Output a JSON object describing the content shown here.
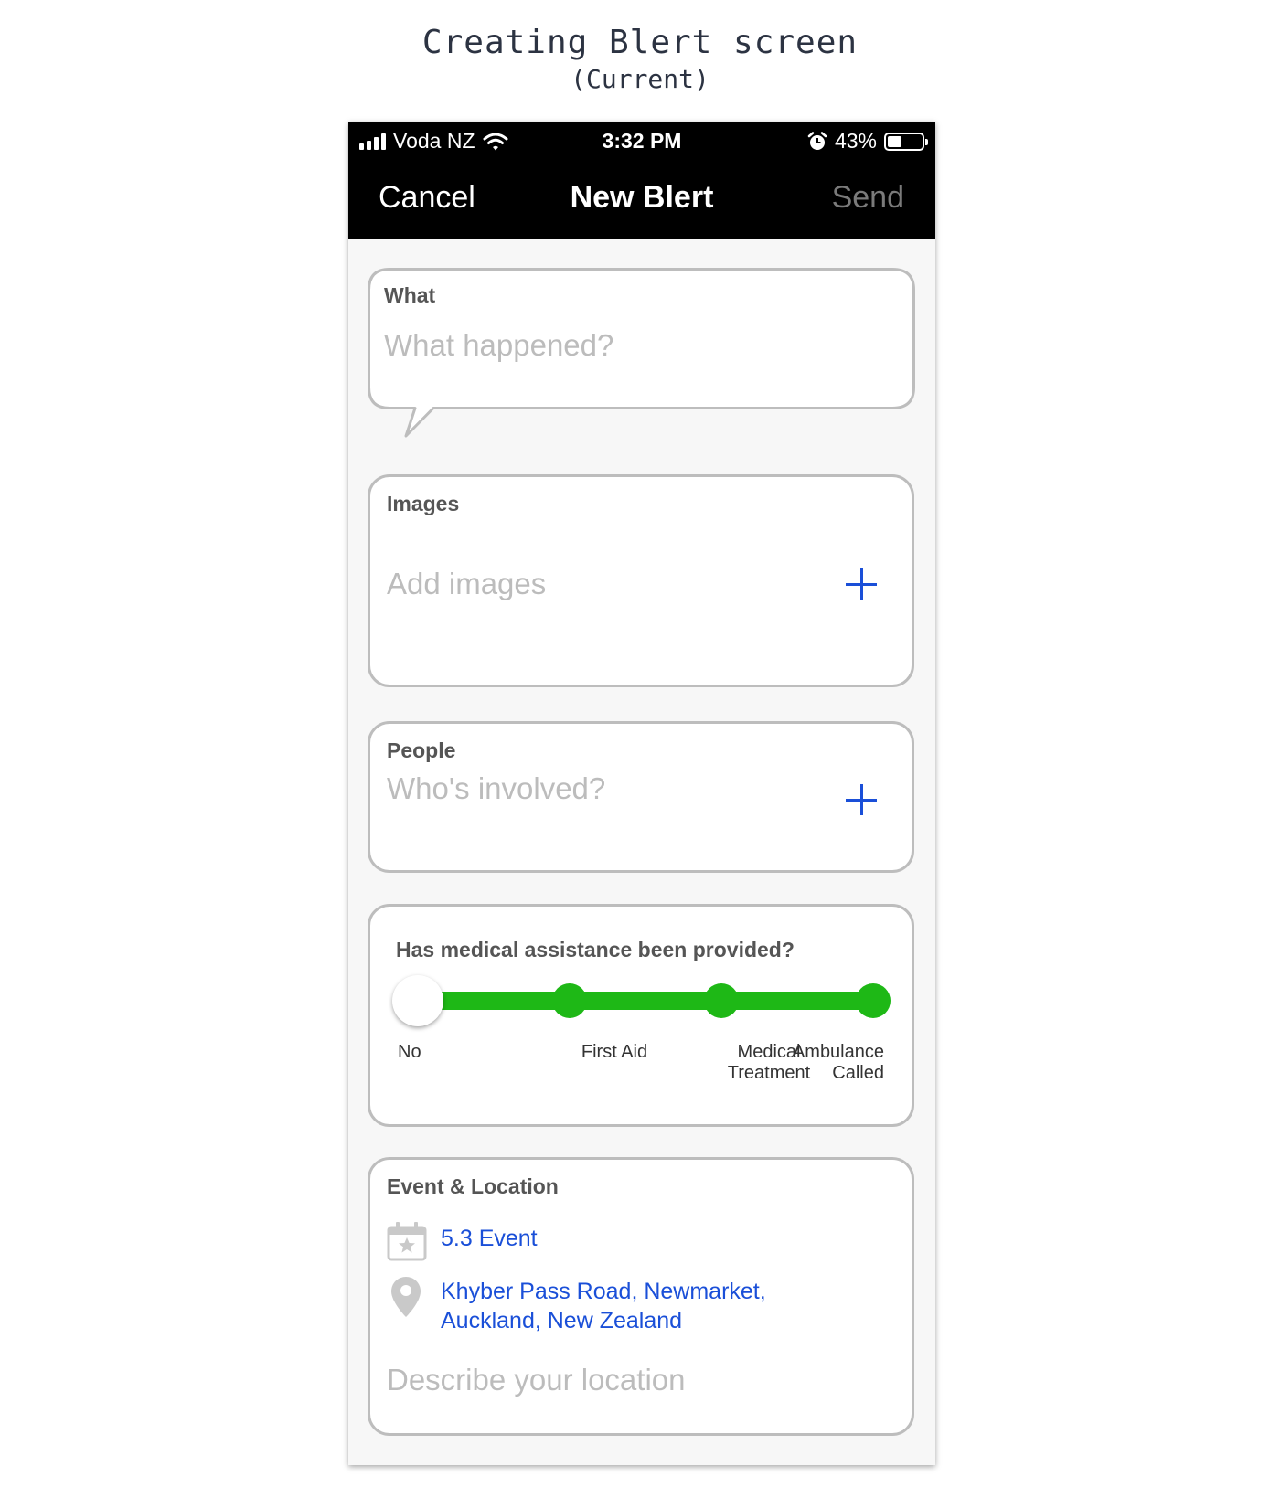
{
  "mockup": {
    "title": "Creating Blert screen",
    "subtitle": "(Current)"
  },
  "status_bar": {
    "carrier": "Voda NZ",
    "time": "3:32 PM",
    "battery": "43%",
    "battery_level": 0.43
  },
  "nav": {
    "cancel": "Cancel",
    "title": "New Blert",
    "send": "Send"
  },
  "what": {
    "label": "What",
    "placeholder": "What happened?"
  },
  "images": {
    "label": "Images",
    "placeholder": "Add images"
  },
  "people": {
    "label": "People",
    "placeholder": "Who's involved?"
  },
  "medical": {
    "question": "Has medical assistance been provided?",
    "options": [
      "No",
      "First Aid",
      "Medical\nTreatment",
      "Ambulance\nCalled"
    ],
    "selected_index": 0,
    "colors": {
      "track": "#1eb816",
      "thumb": "#ffffff"
    }
  },
  "event_location": {
    "label": "Event & Location",
    "event": "5.3 Event",
    "address": "Khyber Pass Road, Newmarket,\nAuckland, New Zealand",
    "placeholder": "Describe your location"
  },
  "colors": {
    "accent": "#1a4fd8",
    "nav_bg": "#000000",
    "send_disabled": "#7a7a7a"
  }
}
